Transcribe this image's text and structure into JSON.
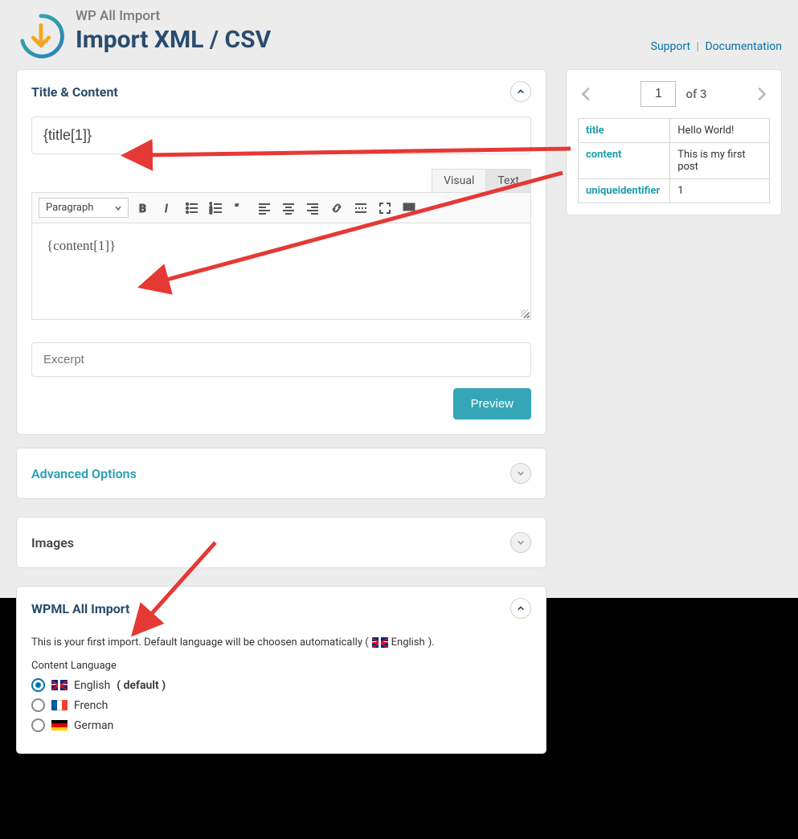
{
  "header": {
    "brand": "WP All Import",
    "title": "Import XML / CSV",
    "support_label": "Support",
    "documentation_label": "Documentation"
  },
  "panel_title_content": {
    "title": "Title & Content",
    "title_field_value": "{title[1]}",
    "editor_tabs": {
      "visual": "Visual",
      "text": "Text"
    },
    "format_label": "Paragraph",
    "editor_value": "{content[1]}",
    "excerpt_placeholder": "Excerpt",
    "preview_label": "Preview"
  },
  "panel_advanced": {
    "title": "Advanced Options"
  },
  "panel_images": {
    "title": "Images"
  },
  "panel_wpml": {
    "title": "WPML All Import",
    "note_prefix": "This is your first import. Default language will be choosen automatically (",
    "note_lang": "English",
    "note_suffix": ").",
    "subhead": "Content Language",
    "options": [
      {
        "label": "English",
        "default_suffix": "( default )",
        "selected": true,
        "flag": "uk"
      },
      {
        "label": "French",
        "default_suffix": "",
        "selected": false,
        "flag": "fr"
      },
      {
        "label": "German",
        "default_suffix": "",
        "selected": false,
        "flag": "de"
      }
    ]
  },
  "preview_panel": {
    "page_value": "1",
    "page_total": "of 3",
    "rows": [
      {
        "key": "title",
        "value": "Hello World!"
      },
      {
        "key": "content",
        "value": "This is my first post"
      },
      {
        "key": "uniqueidentifier",
        "value": "1"
      }
    ]
  }
}
